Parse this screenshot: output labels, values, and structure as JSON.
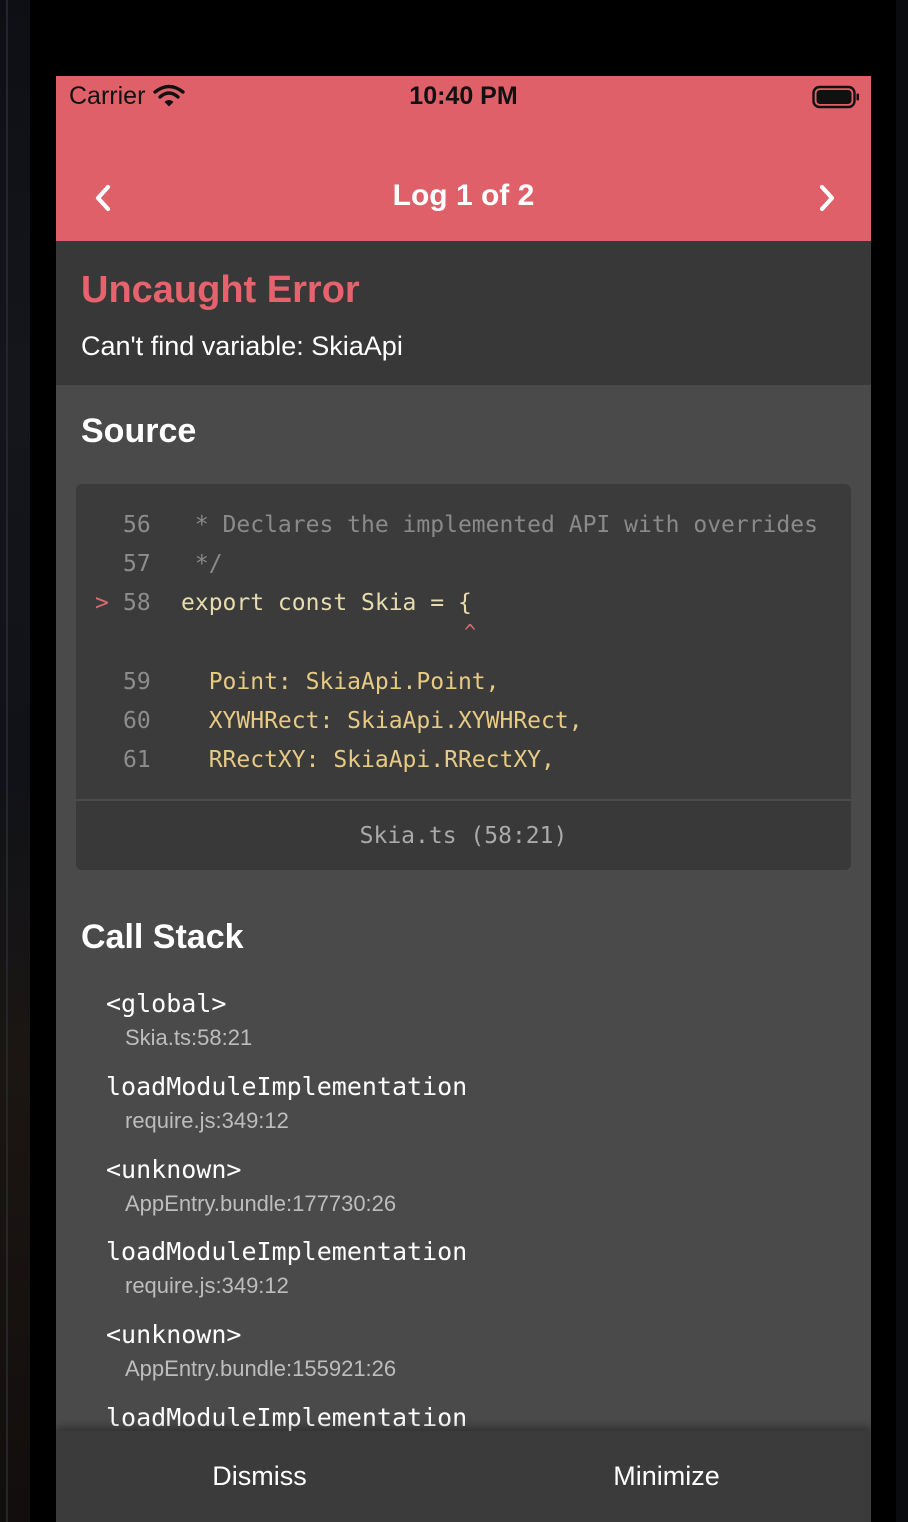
{
  "status_bar": {
    "carrier": "Carrier",
    "time": "10:40 PM",
    "icons": [
      "wifi-icon",
      "battery-icon"
    ]
  },
  "nav": {
    "title": "Log 1 of 2",
    "prev_icon": "chevron-left-icon",
    "next_icon": "chevron-right-icon"
  },
  "error": {
    "title": "Uncaught Error",
    "message": "Can't find variable: SkiaApi"
  },
  "source": {
    "heading": "Source",
    "lines": [
      {
        "marker": "",
        "num": "56",
        "text": " * Declares the implemented API with overrides"
      },
      {
        "marker": "",
        "num": "57",
        "text": " */"
      },
      {
        "marker": ">",
        "num": "58",
        "text": "export const Skia = {"
      },
      {
        "marker": "",
        "num": "59",
        "text": "  Point: SkiaApi.Point,"
      },
      {
        "marker": "",
        "num": "60",
        "text": "  XYWHRect: SkiaApi.XYWHRect,"
      },
      {
        "marker": "",
        "num": "61",
        "text": "  RRectXY: SkiaApi.RRectXY,"
      }
    ],
    "caret": "^",
    "location": "Skia.ts (58:21)"
  },
  "call_stack": {
    "heading": "Call Stack",
    "frames": [
      {
        "name": "<global>",
        "location": "Skia.ts:58:21"
      },
      {
        "name": "loadModuleImplementation",
        "location": "require.js:349:12"
      },
      {
        "name": "<unknown>",
        "location": "AppEntry.bundle:177730:26"
      },
      {
        "name": "loadModuleImplementation",
        "location": "require.js:349:12"
      },
      {
        "name": "<unknown>",
        "location": "AppEntry.bundle:155921:26"
      },
      {
        "name": "loadModuleImplementation",
        "location": ""
      }
    ]
  },
  "footer": {
    "dismiss_label": "Dismiss",
    "minimize_label": "Minimize"
  },
  "colors": {
    "header": "#e0606a",
    "error_title": "#e6636d",
    "background": "#4a4a4a"
  }
}
